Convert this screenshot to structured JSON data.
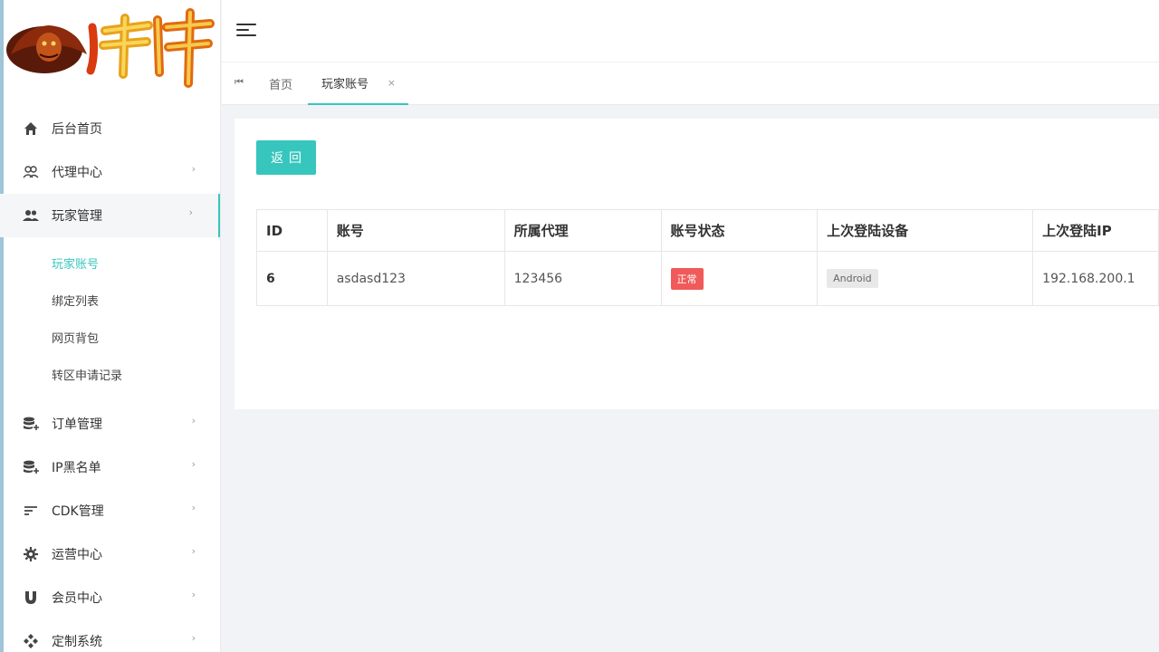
{
  "sidebar": {
    "menu": [
      {
        "label": "后台首页",
        "icon": "home-icon",
        "arrow": ""
      },
      {
        "label": "代理中心",
        "icon": "group-icon",
        "arrow": "›"
      },
      {
        "label": "玩家管理",
        "icon": "users-icon",
        "arrow": "›"
      }
    ],
    "submenu": [
      {
        "label": "玩家账号"
      },
      {
        "label": "绑定列表"
      },
      {
        "label": "网页背包"
      },
      {
        "label": "转区申请记录"
      }
    ],
    "menu2": [
      {
        "label": "订单管理",
        "icon": "database-add-icon",
        "arrow": "›"
      },
      {
        "label": "IP黑名单",
        "icon": "database-add-icon",
        "arrow": "›"
      },
      {
        "label": "CDK管理",
        "icon": "sort-lines-icon",
        "arrow": "›"
      },
      {
        "label": "运营中心",
        "icon": "gear-icon",
        "arrow": "›"
      },
      {
        "label": "会员中心",
        "icon": "magnet-icon",
        "arrow": "›"
      },
      {
        "label": "定制系统",
        "icon": "diamond-dots-icon",
        "arrow": "›"
      }
    ]
  },
  "tabs": {
    "first_icon": "⏮",
    "home": "首页",
    "active": "玩家账号",
    "close": "×"
  },
  "content": {
    "back_button": "返回",
    "table": {
      "headers": [
        "ID",
        "账号",
        "所属代理",
        "账号状态",
        "上次登陆设备",
        "上次登陆IP"
      ],
      "rows": [
        {
          "id": "6",
          "account": "asdasd123",
          "agent": "123456",
          "status": "正常",
          "device": "Android",
          "ip": "192.168.200.1"
        }
      ]
    }
  },
  "colors": {
    "accent": "#36c6bd",
    "status_ok": "#f05a5a"
  }
}
